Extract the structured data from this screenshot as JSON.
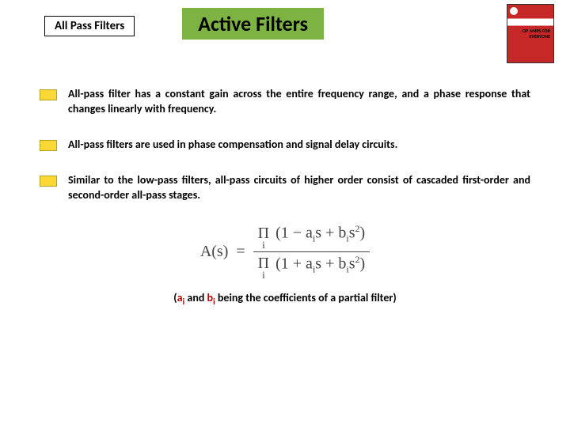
{
  "header": {
    "subtitle": "All Pass Filters",
    "title": "Active Filters"
  },
  "book": {
    "line1": "OP AMPS FOR",
    "line2": "EVERYONE"
  },
  "bullets": [
    "All-pass filter has a constant gain across the entire frequency range, and a phase response that changes linearly with frequency.",
    "All-pass filters are used in phase compensation and signal delay circuits.",
    "Similar to the low-pass filters, all-pass circuits of higher order consist of cascaded first-order and second-order all-pass stages."
  ],
  "formula": {
    "lhs": "A(s)",
    "eq": "=",
    "prod_top": "Π",
    "prod_sub": "i",
    "num_open": "(1 − a",
    "num_mid": "s + b",
    "num_close": "s",
    "sq": "2",
    "paren_close": ")",
    "i": "i",
    "den_open": "(1 + a",
    "den_mid": "s + b"
  },
  "coef_note": {
    "open": "(",
    "a": "a",
    "i": "i",
    "and": " and ",
    "b": "b",
    "rest": " being the coefficients of a partial filter)"
  }
}
